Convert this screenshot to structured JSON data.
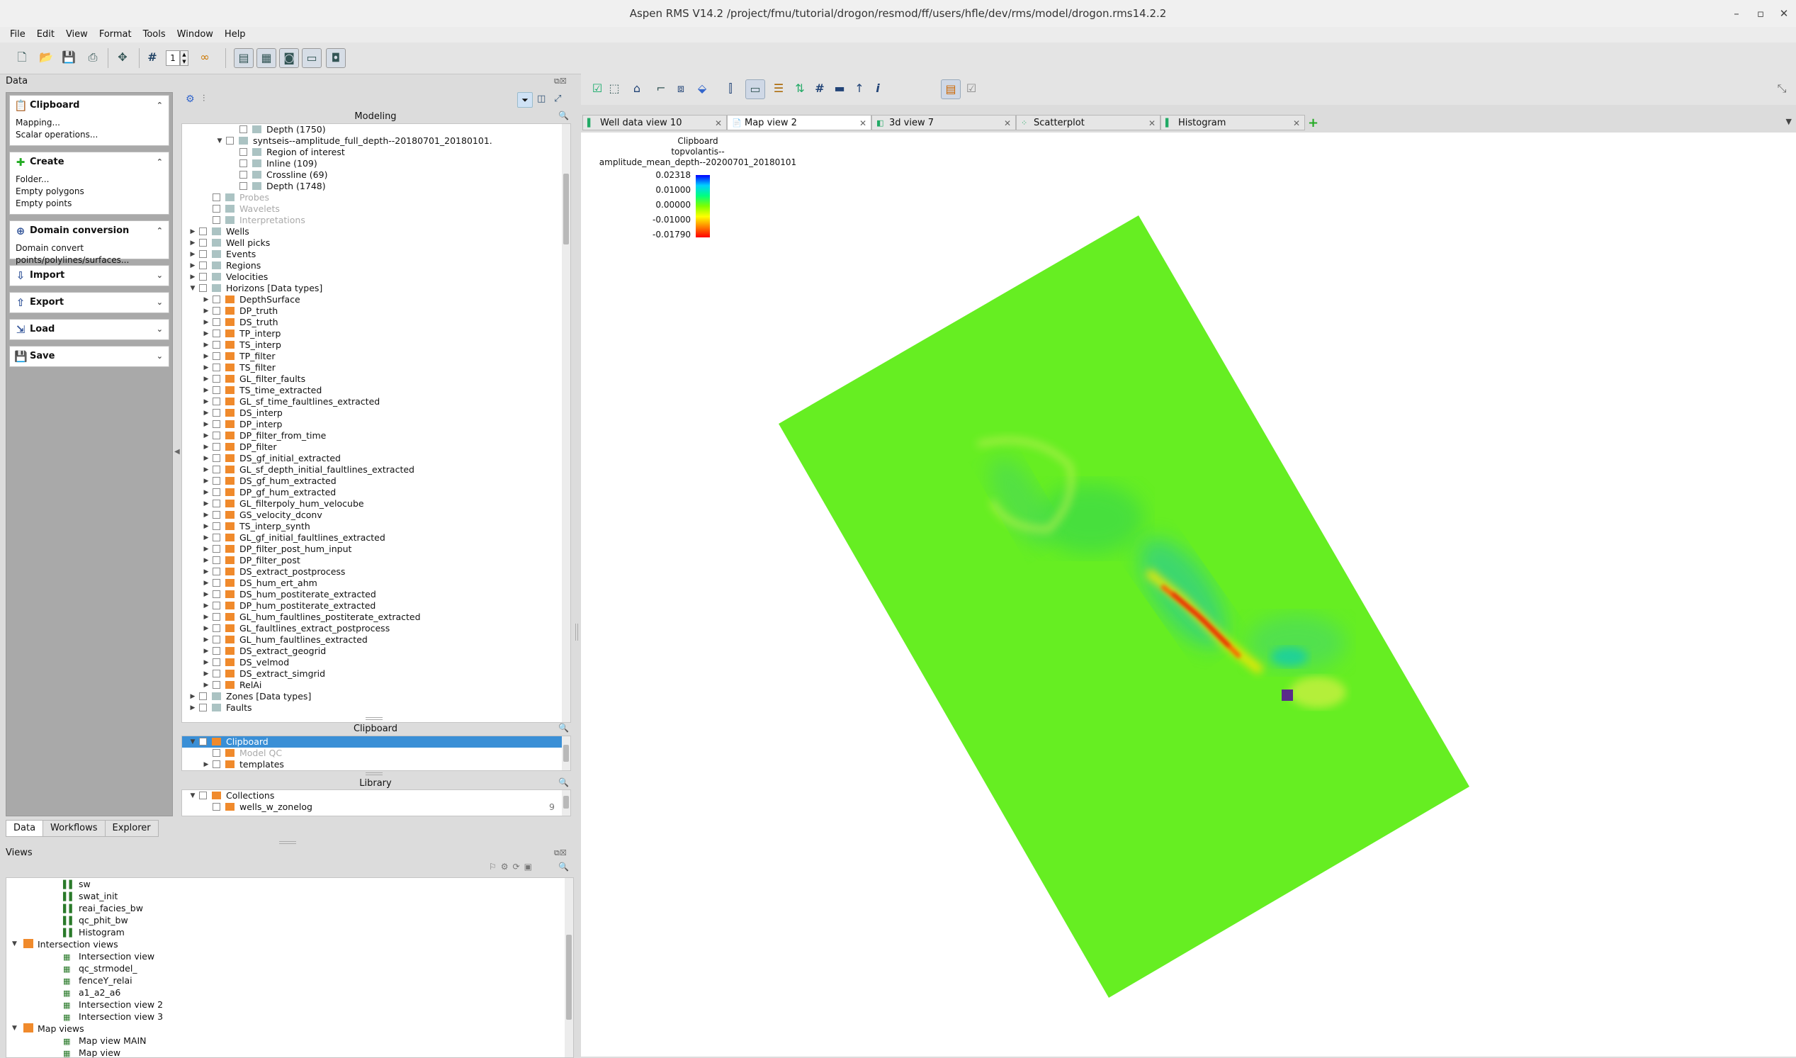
{
  "window": {
    "title": "Aspen RMS V14.2  /project/fmu/tutorial/drogon/resmod/ff/users/hfle/dev/rms/model/drogon.rms14.2.2"
  },
  "menu": [
    "File",
    "Edit",
    "View",
    "Format",
    "Tools",
    "Window",
    "Help"
  ],
  "toolbar": {
    "stepper_value": "1"
  },
  "data_panel": {
    "title": "Data"
  },
  "tasks": [
    {
      "title": "Clipboard",
      "icon": "clipboard-icon",
      "items": [
        "Mapping...",
        "Scalar operations..."
      ],
      "expanded": true
    },
    {
      "title": "Create",
      "icon": "plus-icon",
      "items": [
        "Folder...",
        "Empty polygons",
        "Empty points"
      ],
      "expanded": true
    },
    {
      "title": "Domain conversion",
      "icon": "domain-icon",
      "items": [
        "Domain convert points/polylines/surfaces..."
      ],
      "expanded": true
    },
    {
      "title": "Import",
      "icon": "import-icon",
      "items": [],
      "expanded": false
    },
    {
      "title": "Export",
      "icon": "export-icon",
      "items": [],
      "expanded": false
    },
    {
      "title": "Load",
      "icon": "load-icon",
      "items": [],
      "expanded": false
    },
    {
      "title": "Save",
      "icon": "save-icon",
      "items": [],
      "expanded": false
    }
  ],
  "modeling": {
    "title": "Modeling",
    "rows": [
      {
        "level": 4,
        "label": "Depth (1750)",
        "icon": "depth-icon",
        "arrow": ""
      },
      {
        "level": 3,
        "label": "syntseis--amplitude_full_depth--20180701_20180101.",
        "icon": "seismic-icon",
        "arrow": "open"
      },
      {
        "level": 4,
        "label": "Region of interest",
        "icon": "region-icon",
        "arrow": ""
      },
      {
        "level": 4,
        "label": "Inline (109)",
        "icon": "inline-icon",
        "arrow": ""
      },
      {
        "level": 4,
        "label": "Crossline (69)",
        "icon": "crossline-icon",
        "arrow": ""
      },
      {
        "level": 4,
        "label": "Depth (1748)",
        "icon": "depth-icon",
        "arrow": ""
      },
      {
        "level": 2,
        "label": "Probes",
        "icon": "probe-icon",
        "arrow": "",
        "dim": true
      },
      {
        "level": 2,
        "label": "Wavelets",
        "icon": "wavelet-icon",
        "arrow": "",
        "dim": true
      },
      {
        "level": 2,
        "label": "Interpretations",
        "icon": "interp-icon",
        "arrow": "",
        "dim": true
      },
      {
        "level": 1,
        "label": "Wells",
        "icon": "wells-icon",
        "arrow": "closed"
      },
      {
        "level": 1,
        "label": "Well picks",
        "icon": "wellpicks-icon",
        "arrow": "closed"
      },
      {
        "level": 1,
        "label": "Events",
        "icon": "events-icon",
        "arrow": "closed"
      },
      {
        "level": 1,
        "label": "Regions",
        "icon": "regions-icon",
        "arrow": "closed"
      },
      {
        "level": 1,
        "label": "Velocities",
        "icon": "velocities-icon",
        "arrow": "closed"
      },
      {
        "level": 1,
        "label": "Horizons [Data types]",
        "icon": "horizons-icon",
        "arrow": "open"
      },
      {
        "level": 2,
        "label": "DepthSurface",
        "icon": "folder-icon",
        "arrow": "closed"
      },
      {
        "level": 2,
        "label": "DP_truth",
        "icon": "folder-icon",
        "arrow": "closed"
      },
      {
        "level": 2,
        "label": "DS_truth",
        "icon": "folder-icon",
        "arrow": "closed"
      },
      {
        "level": 2,
        "label": "TP_interp",
        "icon": "folder-icon",
        "arrow": "closed"
      },
      {
        "level": 2,
        "label": "TS_interp",
        "icon": "folder-icon",
        "arrow": "closed"
      },
      {
        "level": 2,
        "label": "TP_filter",
        "icon": "folder-icon",
        "arrow": "closed"
      },
      {
        "level": 2,
        "label": "TS_filter",
        "icon": "folder-icon",
        "arrow": "closed"
      },
      {
        "level": 2,
        "label": "GL_filter_faults",
        "icon": "folder-icon",
        "arrow": "closed"
      },
      {
        "level": 2,
        "label": "TS_time_extracted",
        "icon": "folder-icon",
        "arrow": "closed"
      },
      {
        "level": 2,
        "label": "GL_sf_time_faultlines_extracted",
        "icon": "folder-icon",
        "arrow": "closed"
      },
      {
        "level": 2,
        "label": "DS_interp",
        "icon": "folder-icon",
        "arrow": "closed"
      },
      {
        "level": 2,
        "label": "DP_interp",
        "icon": "folder-icon",
        "arrow": "closed"
      },
      {
        "level": 2,
        "label": "DP_filter_from_time",
        "icon": "folder-icon",
        "arrow": "closed"
      },
      {
        "level": 2,
        "label": "DP_filter",
        "icon": "folder-icon",
        "arrow": "closed"
      },
      {
        "level": 2,
        "label": "DS_gf_initial_extracted",
        "icon": "folder-icon",
        "arrow": "closed"
      },
      {
        "level": 2,
        "label": "GL_sf_depth_initial_faultlines_extracted",
        "icon": "folder-icon",
        "arrow": "closed"
      },
      {
        "level": 2,
        "label": "DS_gf_hum_extracted",
        "icon": "folder-icon",
        "arrow": "closed"
      },
      {
        "level": 2,
        "label": "DP_gf_hum_extracted",
        "icon": "folder-icon",
        "arrow": "closed"
      },
      {
        "level": 2,
        "label": "GL_filterpoly_hum_velocube",
        "icon": "folder-icon",
        "arrow": "closed"
      },
      {
        "level": 2,
        "label": "GS_velocity_dconv",
        "icon": "folder-icon",
        "arrow": "closed"
      },
      {
        "level": 2,
        "label": "TS_interp_synth",
        "icon": "folder-icon",
        "arrow": "closed"
      },
      {
        "level": 2,
        "label": "GL_gf_initial_faultlines_extracted",
        "icon": "folder-icon",
        "arrow": "closed"
      },
      {
        "level": 2,
        "label": "DP_filter_post_hum_input",
        "icon": "folder-icon",
        "arrow": "closed"
      },
      {
        "level": 2,
        "label": "DP_filter_post",
        "icon": "folder-icon",
        "arrow": "closed"
      },
      {
        "level": 2,
        "label": "DS_extract_postprocess",
        "icon": "folder-icon",
        "arrow": "closed"
      },
      {
        "level": 2,
        "label": "DS_hum_ert_ahm",
        "icon": "folder-icon",
        "arrow": "closed"
      },
      {
        "level": 2,
        "label": "DS_hum_postiterate_extracted",
        "icon": "folder-icon",
        "arrow": "closed"
      },
      {
        "level": 2,
        "label": "DP_hum_postiterate_extracted",
        "icon": "folder-icon",
        "arrow": "closed"
      },
      {
        "level": 2,
        "label": "GL_hum_faultlines_postiterate_extracted",
        "icon": "folder-icon",
        "arrow": "closed"
      },
      {
        "level": 2,
        "label": "GL_faultlines_extract_postprocess",
        "icon": "folder-icon",
        "arrow": "closed"
      },
      {
        "level": 2,
        "label": "GL_hum_faultlines_extracted",
        "icon": "folder-icon",
        "arrow": "closed"
      },
      {
        "level": 2,
        "label": "DS_extract_geogrid",
        "icon": "folder-icon",
        "arrow": "closed"
      },
      {
        "level": 2,
        "label": "DS_velmod",
        "icon": "folder-icon",
        "arrow": "closed"
      },
      {
        "level": 2,
        "label": "DS_extract_simgrid",
        "icon": "folder-icon",
        "arrow": "closed"
      },
      {
        "level": 2,
        "label": "RelAi",
        "icon": "folder-icon",
        "arrow": "closed"
      },
      {
        "level": 1,
        "label": "Zones [Data types]",
        "icon": "zones-icon",
        "arrow": "closed"
      },
      {
        "level": 1,
        "label": "Faults",
        "icon": "faults-icon",
        "arrow": "closed"
      }
    ]
  },
  "clipboard_tree": {
    "title": "Clipboard",
    "rows": [
      {
        "level": 1,
        "label": "Clipboard",
        "arrow": "open",
        "selected": true
      },
      {
        "level": 2,
        "label": "Model QC",
        "arrow": "",
        "dim": true
      },
      {
        "level": 2,
        "label": "templates",
        "arrow": "closed"
      }
    ]
  },
  "library_tree": {
    "title": "Library",
    "rows": [
      {
        "level": 1,
        "label": "Collections",
        "arrow": "open",
        "count": ""
      },
      {
        "level": 2,
        "label": "wells_w_zonelog",
        "arrow": "",
        "count": "9"
      }
    ]
  },
  "bottom_tabs": [
    "Data",
    "Workflows",
    "Explorer"
  ],
  "views_panel": {
    "title": "Views",
    "rows": [
      {
        "level": 2,
        "label": "sw",
        "kind": "chart"
      },
      {
        "level": 2,
        "label": "swat_init",
        "kind": "chart"
      },
      {
        "level": 2,
        "label": "reai_facies_bw",
        "kind": "chart"
      },
      {
        "level": 2,
        "label": "qc_phit_bw",
        "kind": "chart"
      },
      {
        "level": 2,
        "label": "Histogram",
        "kind": "chart"
      },
      {
        "level": 1,
        "label": "Intersection views",
        "kind": "folder"
      },
      {
        "level": 2,
        "label": "Intersection view",
        "kind": "intersection"
      },
      {
        "level": 2,
        "label": "qc_strmodel_",
        "kind": "intersection"
      },
      {
        "level": 2,
        "label": "fenceY_relai",
        "kind": "intersection"
      },
      {
        "level": 2,
        "label": "a1_a2_a6",
        "kind": "intersection"
      },
      {
        "level": 2,
        "label": "Intersection view 2",
        "kind": "intersection"
      },
      {
        "level": 2,
        "label": "Intersection view 3",
        "kind": "intersection"
      },
      {
        "level": 1,
        "label": "Map views",
        "kind": "folder"
      },
      {
        "level": 2,
        "label": "Map view MAIN",
        "kind": "map"
      },
      {
        "level": 2,
        "label": "Map view",
        "kind": "map"
      }
    ]
  },
  "view_tabs": [
    {
      "label": "Well data view 10",
      "icon": "well-view-icon",
      "selected": false
    },
    {
      "label": "Map view 2",
      "icon": "map-view-icon",
      "selected": true
    },
    {
      "label": "3d view 7",
      "icon": "3d-view-icon",
      "selected": false
    },
    {
      "label": "Scatterplot",
      "icon": "scatter-icon",
      "selected": false
    },
    {
      "label": "Histogram",
      "icon": "histogram-icon",
      "selected": false
    }
  ],
  "map_legend": {
    "title_lines": [
      "Clipboard",
      "topvolantis--",
      "amplitude_mean_depth--20200701_20180101"
    ],
    "labels": [
      "0.02318",
      "0.01000",
      "0.00000",
      "-0.01000",
      "-0.01790"
    ],
    "colors": [
      "#0000ff",
      "#00d0ff",
      "#00ff80",
      "#80ff00",
      "#ffff00",
      "#ff8000",
      "#ff0000"
    ]
  },
  "colors": {
    "accent": "#3a8fd6",
    "map_fill": "#66ee22",
    "folder": "#f08a2c"
  }
}
